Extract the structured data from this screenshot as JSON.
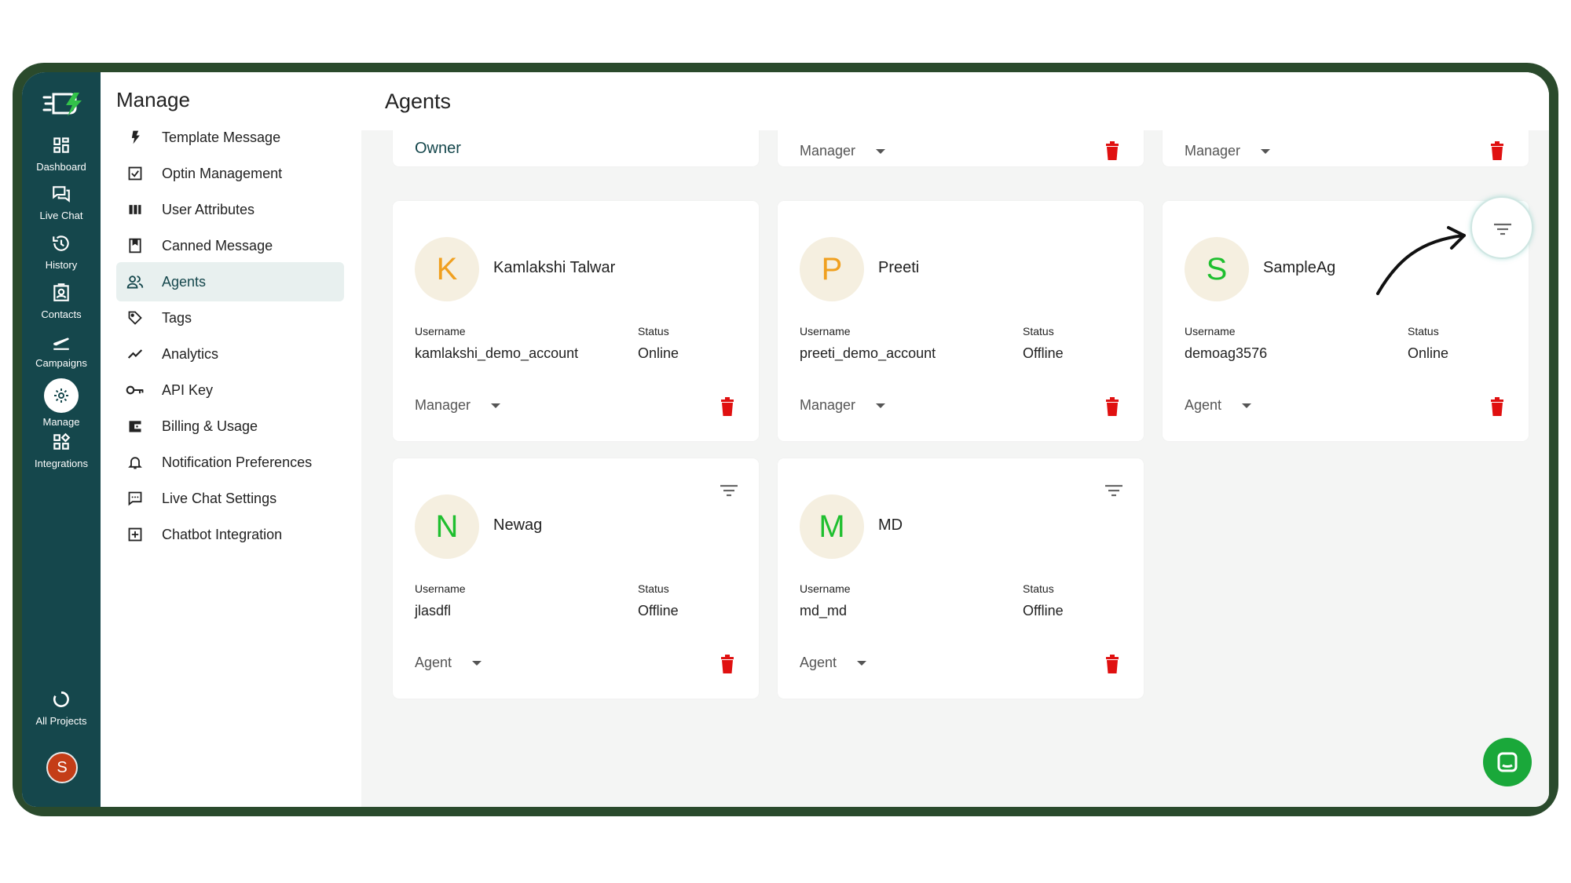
{
  "rail": {
    "items": [
      {
        "label": "Dashboard",
        "icon": "dashboard-icon"
      },
      {
        "label": "Live Chat",
        "icon": "chat-icon"
      },
      {
        "label": "History",
        "icon": "history-icon"
      },
      {
        "label": "Contacts",
        "icon": "contacts-icon"
      },
      {
        "label": "Campaigns",
        "icon": "campaigns-icon"
      },
      {
        "label": "Manage",
        "icon": "gear-icon"
      },
      {
        "label": "Integrations",
        "icon": "integrations-icon"
      },
      {
        "label": "All Projects",
        "icon": "projects-icon"
      }
    ],
    "user_initial": "S"
  },
  "manage": {
    "title": "Manage",
    "items": [
      {
        "label": "Template Message",
        "icon": "bolt-icon"
      },
      {
        "label": "Optin Management",
        "icon": "checkbox-icon"
      },
      {
        "label": "User Attributes",
        "icon": "columns-icon"
      },
      {
        "label": "Canned Message",
        "icon": "bookmark-icon"
      },
      {
        "label": "Agents",
        "icon": "people-icon",
        "active": true
      },
      {
        "label": "Tags",
        "icon": "tag-icon"
      },
      {
        "label": "Analytics",
        "icon": "analytics-icon"
      },
      {
        "label": "API Key",
        "icon": "key-icon"
      },
      {
        "label": "Billing & Usage",
        "icon": "wallet-icon"
      },
      {
        "label": "Notification Preferences",
        "icon": "bell-icon"
      },
      {
        "label": "Live Chat Settings",
        "icon": "chat-settings-icon"
      },
      {
        "label": "Chatbot Integration",
        "icon": "chatbot-icon"
      }
    ]
  },
  "main": {
    "title": "Agents",
    "top_cards": [
      {
        "text": "Owner"
      },
      {
        "role": "Manager"
      },
      {
        "role": "Manager"
      }
    ],
    "cards": [
      {
        "initial": "K",
        "initial_color": "#f0a020",
        "name": "Kamlakshi Talwar",
        "username_label": "Username",
        "username": "kamlakshi_demo_account",
        "status_label": "Status",
        "status": "Online",
        "role": "Manager"
      },
      {
        "initial": "P",
        "initial_color": "#f0a020",
        "name": "Preeti",
        "username_label": "Username",
        "username": "preeti_demo_account",
        "status_label": "Status",
        "status": "Offline",
        "role": "Manager"
      },
      {
        "initial": "S",
        "initial_color": "#1fbf2f",
        "name": "SampleAg",
        "username_label": "Username",
        "username": "demoag3576",
        "status_label": "Status",
        "status": "Online",
        "role": "Agent"
      },
      {
        "initial": "N",
        "initial_color": "#1fbf2f",
        "name": "Newag",
        "username_label": "Username",
        "username": "jlasdfl",
        "status_label": "Status",
        "status": "Offline",
        "role": "Agent"
      },
      {
        "initial": "M",
        "initial_color": "#1fbf2f",
        "name": "MD",
        "username_label": "Username",
        "username": "md_md",
        "status_label": "Status",
        "status": "Offline",
        "role": "Agent"
      }
    ]
  },
  "colors": {
    "rail": "#15474c",
    "delete": "#e01010",
    "accent": "#1aa83a",
    "frame": "#2a4a2c"
  }
}
